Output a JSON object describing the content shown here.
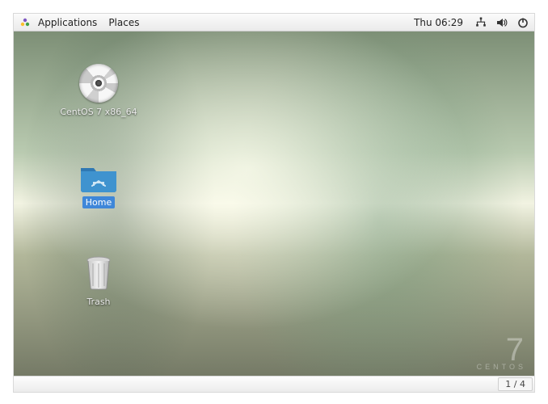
{
  "panel": {
    "menus": {
      "applications": "Applications",
      "places": "Places"
    },
    "clock": "Thu 06:29"
  },
  "desktop": {
    "icons": {
      "disc": {
        "label": "CentOS 7 x86_64"
      },
      "home": {
        "label": "Home"
      },
      "trash": {
        "label": "Trash"
      }
    },
    "watermark": {
      "big": "7",
      "small": "CENTOS"
    }
  },
  "viewer": {
    "pager": "1 / 4"
  }
}
